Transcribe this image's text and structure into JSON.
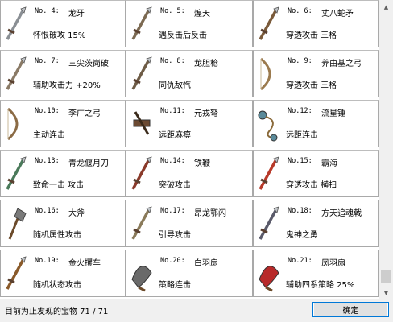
{
  "items": [
    {
      "no": "No. 4:",
      "name": "龙牙",
      "desc": "怀恨破攻 15%",
      "icon": "sword-icon",
      "color": "#8a8f94"
    },
    {
      "no": "No. 5:",
      "name": "煌天",
      "desc": "遇反击后反击",
      "icon": "halberd-icon",
      "color": "#7c6a52"
    },
    {
      "no": "No. 6:",
      "name": "丈八蛇矛",
      "desc": "穿透攻击 三格",
      "icon": "snake-spear-icon",
      "color": "#7a5a3a"
    },
    {
      "no": "No. 7:",
      "name": "三尖茨岗破",
      "desc": "辅助攻击力 +20%",
      "icon": "trident-icon",
      "color": "#8a7a66"
    },
    {
      "no": "No. 8:",
      "name": "龙胆枪",
      "desc": "同仇敌忾",
      "icon": "spear-icon",
      "color": "#6e5c46"
    },
    {
      "no": "No. 9:",
      "name": "养由基之弓",
      "desc": "穿透攻击 三格",
      "icon": "bow-icon",
      "color": "#9b7a4e"
    },
    {
      "no": "No.10:",
      "name": "李广之弓",
      "desc": "主动连击",
      "icon": "bow-icon",
      "color": "#8b6b45"
    },
    {
      "no": "No.11:",
      "name": "元戎弩",
      "desc": "远距麻痹",
      "icon": "crossbow-icon",
      "color": "#6b4a32"
    },
    {
      "no": "No.12:",
      "name": "流星锤",
      "desc": "远距连击",
      "icon": "meteor-hammer-icon",
      "color": "#5a8a9a"
    },
    {
      "no": "No.13:",
      "name": "青龙偃月刀",
      "desc": "致命一击 攻击",
      "icon": "glaive-icon",
      "color": "#4a7a5a"
    },
    {
      "no": "No.14:",
      "name": "铁鞭",
      "desc": "突破攻击",
      "icon": "iron-whip-icon",
      "color": "#8a3a2a"
    },
    {
      "no": "No.15:",
      "name": "霸海",
      "desc": "穿透攻击 横扫",
      "icon": "blade-icon",
      "color": "#b83a2a"
    },
    {
      "no": "No.16:",
      "name": "大斧",
      "desc": "随机属性攻击",
      "icon": "axe-icon",
      "color": "#7a7a7a"
    },
    {
      "no": "No.17:",
      "name": "昂龙鄂闪",
      "desc": "引导攻击",
      "icon": "long-spear-icon",
      "color": "#8a7a5a"
    },
    {
      "no": "No.18:",
      "name": "方天追魂戟",
      "desc": "鬼神之勇",
      "icon": "halberd-icon",
      "color": "#5a5a6a"
    },
    {
      "no": "No.19:",
      "name": "金火攫车",
      "desc": "随机状态攻击",
      "icon": "gold-fire-icon",
      "color": "#8a5a2a"
    },
    {
      "no": "No.20:",
      "name": "白羽扇",
      "desc": "策略连击",
      "icon": "feather-fan-icon",
      "color": "#6a6a6a"
    },
    {
      "no": "No.21:",
      "name": "凤羽扇",
      "desc": "辅助四系策略 25%",
      "icon": "phoenix-fan-icon",
      "color": "#b82a2a"
    }
  ],
  "footer": {
    "label": "目前为止发现的宝物 71 / 71",
    "ok_label": "确定"
  }
}
